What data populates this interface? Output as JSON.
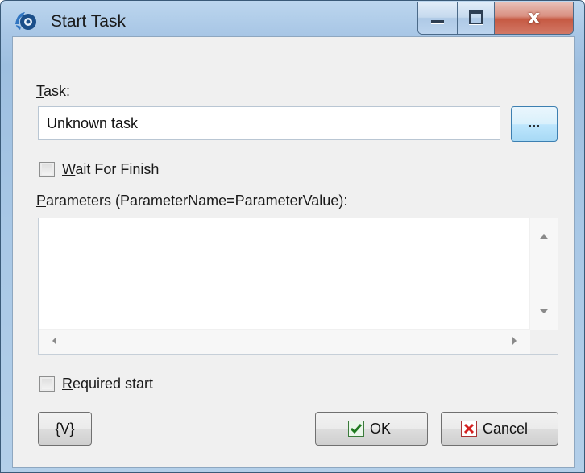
{
  "window": {
    "title": "Start Task"
  },
  "caption": {
    "minimize_icon": "minimize-icon",
    "maximize_icon": "maximize-icon",
    "close_glyph": "x"
  },
  "task": {
    "label_key": "T",
    "label_rest": "ask:",
    "value": "Unknown task",
    "browse_label": "..."
  },
  "wait_for_finish": {
    "label_key": "W",
    "label_rest": "ait For Finish",
    "checked": false
  },
  "parameters": {
    "label_key": "P",
    "label_rest": "arameters (ParameterName=ParameterValue):",
    "value": ""
  },
  "required_start": {
    "label_key": "R",
    "label_rest": "equired start",
    "checked": false
  },
  "buttons": {
    "variables": "{V}",
    "ok": "OK",
    "cancel": "Cancel"
  },
  "icons": {
    "app": "task-app-icon",
    "ok": "check-icon",
    "cancel": "x-icon"
  },
  "colors": {
    "ok_check": "#1f7a1f",
    "cancel_x": "#d42020",
    "browse_border": "#3c7fb1"
  }
}
